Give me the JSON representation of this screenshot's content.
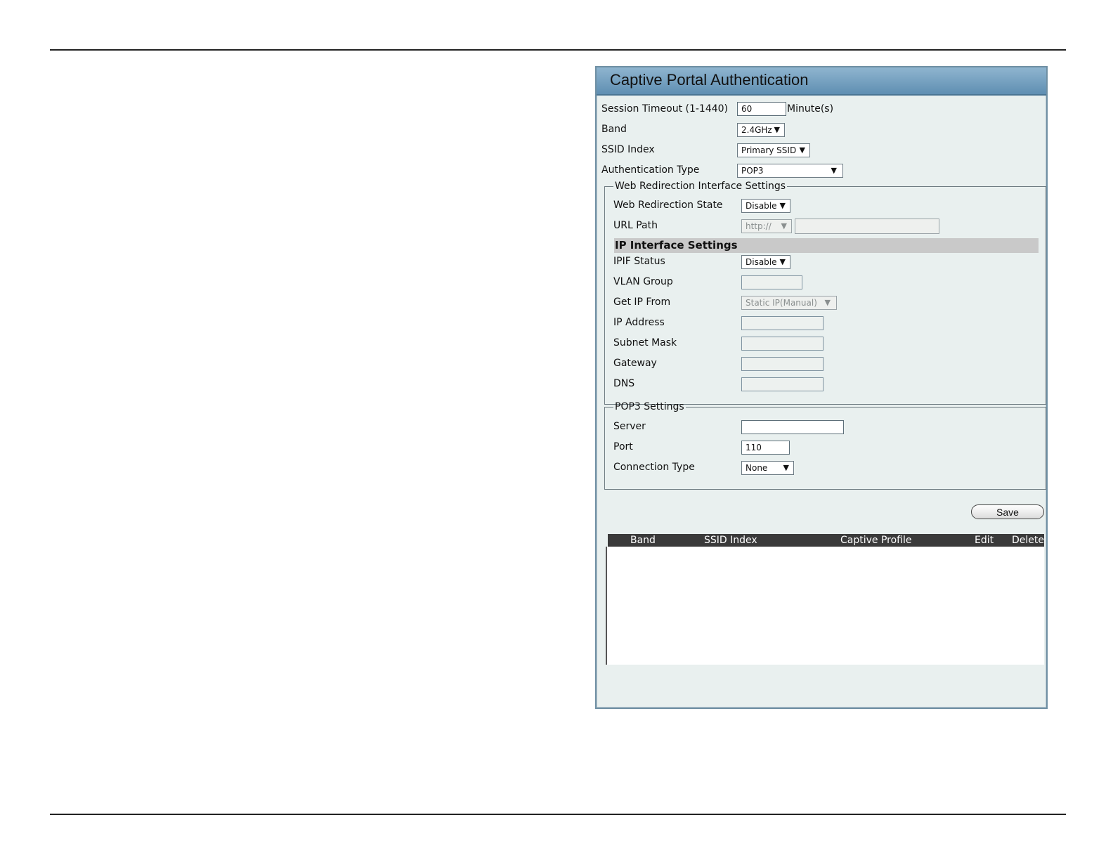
{
  "panel": {
    "title": "Captive Portal Authentication"
  },
  "session_timeout": {
    "label": "Session Timeout (1-1440)",
    "value": "60",
    "unit": "Minute(s)"
  },
  "band": {
    "label": "Band",
    "value": "2.4GHz"
  },
  "ssid_index": {
    "label": "SSID Index",
    "value": "Primary SSID"
  },
  "auth_type": {
    "label": "Authentication Type",
    "value": "POP3"
  },
  "web_redirection": {
    "legend": "Web Redirection Interface Settings",
    "state_label": "Web Redirection State",
    "state_value": "Disable",
    "url_label": "URL Path",
    "url_scheme": "http://",
    "url_value": ""
  },
  "ip_interface": {
    "heading": "IP Interface Settings",
    "ipif_status_label": "IPIF Status",
    "ipif_status_value": "Disable",
    "vlan_group_label": "VLAN Group",
    "vlan_group_value": "",
    "get_ip_label": "Get IP From",
    "get_ip_value": "Static IP(Manual)",
    "ip_address_label": "IP Address",
    "subnet_mask_label": "Subnet Mask",
    "gateway_label": "Gateway",
    "dns_label": "DNS"
  },
  "pop3": {
    "legend": "POP3 Settings",
    "server_label": "Server",
    "server_value": "",
    "port_label": "Port",
    "port_value": "110",
    "connection_type_label": "Connection Type",
    "connection_type_value": "None"
  },
  "save_label": "Save",
  "table": {
    "columns": [
      "Band",
      "SSID Index",
      "Captive Profile",
      "Edit",
      "Delete"
    ],
    "rows": []
  },
  "icons": {
    "dropdown": "▼"
  }
}
